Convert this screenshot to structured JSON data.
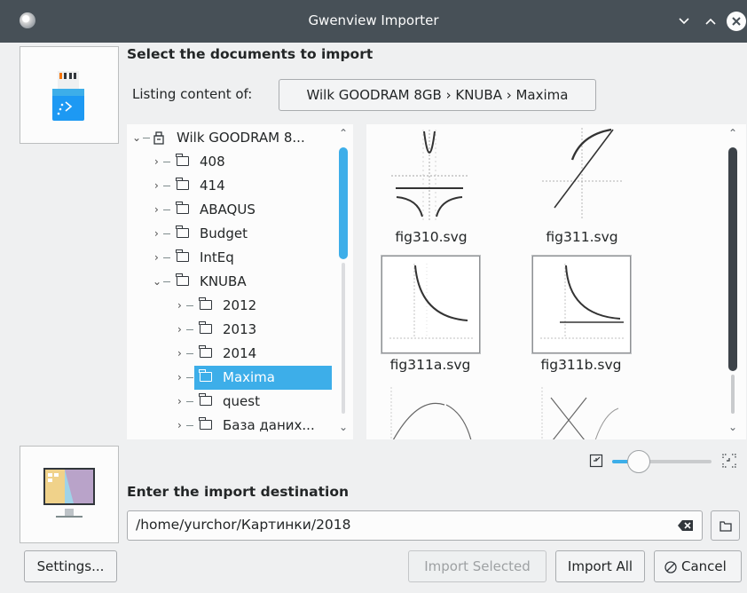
{
  "window": {
    "title": "Gwenview Importer"
  },
  "source": {
    "heading": "Select the documents to import",
    "listing_label": "Listing content of:",
    "path_button": "Wilk GOODRAM 8GB › KNUBA › Maxima"
  },
  "tree": {
    "root": "Wilk GOODRAM 8...",
    "items": [
      "408",
      "414",
      "ABAQUS",
      "Budget",
      "IntEq",
      "KNUBA",
      "2012",
      "2013",
      "2014",
      "Maxima",
      "quest",
      "База даних..."
    ],
    "selected": "Maxima"
  },
  "thumbnails": [
    {
      "name": "fig310.svg"
    },
    {
      "name": "fig311.svg"
    },
    {
      "name": "fig311a.svg"
    },
    {
      "name": "fig311b.svg"
    }
  ],
  "zoom": {
    "level": 0.2
  },
  "destination": {
    "heading": "Enter the import destination",
    "path": "/home/yurchor/Картинки/2018"
  },
  "buttons": {
    "settings": "Settings...",
    "import_selected": "Import Selected",
    "import_all": "Import All",
    "cancel": "Cancel"
  },
  "colors": {
    "accent": "#3daee9",
    "titlebar": "#475057",
    "window_bg": "#eff0f1"
  }
}
